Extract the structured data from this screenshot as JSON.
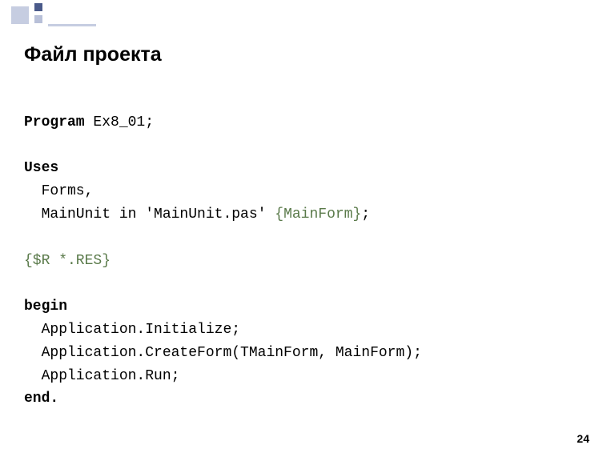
{
  "title": "Файл проекта",
  "page_number": "24",
  "code": {
    "program_kw": "Program",
    "program_name": " Ex8_01;",
    "uses_kw": "Uses",
    "forms_line": "  Forms,",
    "mainunit_prefix": "  MainUnit in 'MainUnit.pas' ",
    "mainunit_comment": "{MainForm}",
    "mainunit_suffix": ";",
    "directive": "{$R *.RES}",
    "begin_kw": "begin",
    "init_line": "  Application.Initialize;",
    "createform_line": "  Application.CreateForm(TMainForm, MainForm);",
    "run_line": "  Application.Run;",
    "end_kw": "end."
  }
}
